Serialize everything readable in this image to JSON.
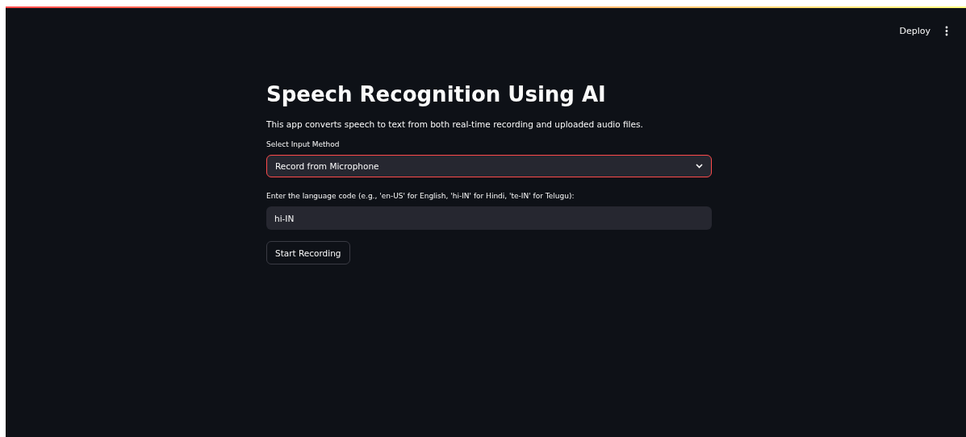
{
  "header": {
    "deploy": "Deploy"
  },
  "title": "Speech Recognition Using AI",
  "description": "This app converts speech to text from both real-time recording and uploaded audio files.",
  "select": {
    "label": "Select Input Method",
    "value": "Record from Microphone",
    "focused": true
  },
  "language": {
    "label": "Enter the language code (e.g., 'en-US' for English, 'hi-IN' for Hindi, 'te-IN' for Telugu):",
    "value": "hi-IN"
  },
  "button": "Start Recording"
}
